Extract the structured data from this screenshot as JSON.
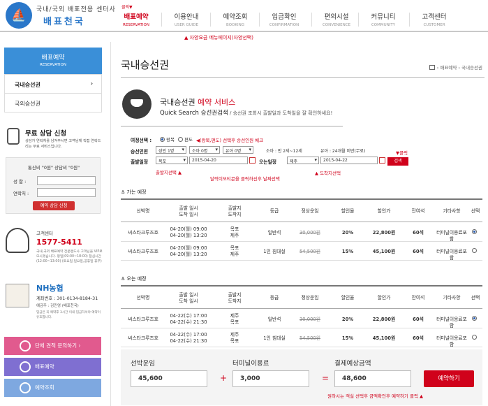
{
  "header": {
    "logo_text1": "국내/국외 배표전용 센터사",
    "logo_text2": "배표천국",
    "click_hint": "클릭▼",
    "nav": [
      {
        "k": "배표예약",
        "e": "RESERVATION",
        "active": true
      },
      {
        "k": "이용안내",
        "e": "USER GUIDE"
      },
      {
        "k": "예약조회",
        "e": "BOOKING"
      },
      {
        "k": "입금확인",
        "e": "CONFIRMATION"
      },
      {
        "k": "편의시설",
        "e": "CONVENIENCE"
      },
      {
        "k": "커뮤니티",
        "e": "COMMUNITY"
      },
      {
        "k": "고객센터",
        "e": "CUSTOMER"
      }
    ],
    "menu_tip": "▲ 자양요금 메뉴페이지(자양선택)"
  },
  "sidebar": {
    "top_k": "배표예약",
    "top_e": "RESERVATION",
    "items": [
      {
        "label": "국내승선권",
        "arrow": "›"
      },
      {
        "label": "국외승선권"
      }
    ],
    "consult_title": "무료 상담 신청",
    "consult_desc": "상담가 연락처를 남겨주시면 고객님께 직접 연락드리는 무료 서비스입니다.",
    "consult_head": "통신비 \"0원\" 상담비 \"0원\"",
    "name_label": "성 함 :",
    "phone_label": "연락처 :",
    "apply_label": "예약 상담 신청",
    "cs_label": "고객센터",
    "cs_phone": "1577-5411",
    "cs_desc": "국내,국외 배표예약 전문랜드사 고객님을 VIP로 모시겠습니다. 평일(09:00~18:00) 점심시간(12:00~13:00) (토요일,일요일,공휴일 휴무)",
    "nh_logo": "NH농협",
    "nh_acct": "계좌번호 : 301-0134-8184-31",
    "nh_name": "예금주 : 김민영 (배표천국)",
    "nh_note": "입금은 꼭 예약후 3시간 이내 입금하셔야 예약이 유효합니다.",
    "btn_group": "단체 견적 문의하기 ›",
    "btn_reserve": "배표예약",
    "btn_inquiry": "예약조회"
  },
  "main": {
    "title": "국내승선권",
    "breadcrumb": "› 배표예약 › 국내승선권",
    "svc_title_a": "국내승선권",
    "svc_title_b": "예약 서비스",
    "svc_sub_a": "Quick Search 승선권검색",
    "svc_sub_b": "/ 승선권 조회시 출발일과 도착일을 잘 확인하세요!"
  },
  "search": {
    "trip_label": "여정선택 :",
    "round": "왕복",
    "oneway": "편도",
    "trip_tip": "◀(왕복,편도) 선택후 승선인원 체크",
    "pax_label": "승선인원",
    "adult": "성인 1명",
    "child": "소아 0명",
    "infant": "유아 0명",
    "child_note": "소아 : 만 2세~12세",
    "infant_note": "유아 : 24개월 미만(무료)",
    "click_tip": "▼클릭",
    "dep_label": "출발일정",
    "dep_port": "목포",
    "dep_date": "2015-04-20",
    "ret_label": "오는일정",
    "ret_port": "제주",
    "ret_date": "2015-04-22",
    "search_btn": "검색",
    "tip_dep": "출발지선택 ▲",
    "tip_cal": "달력이모티콘을 클릭하신후 날짜선택",
    "tip_arr": "▲ 도착지선택"
  },
  "columns": [
    "선박명",
    "출발 일시|도착 일시",
    "출발지|도착지",
    "등급",
    "정상운임",
    "할인율",
    "할인가",
    "잔여석",
    "기타사항",
    "선택"
  ],
  "go": {
    "head": "⚓ 가는 예정",
    "rows": [
      {
        "ship": "씨스타크루즈호",
        "t1": "04-20(월) 09:00",
        "t2": "04-20(월) 13:20",
        "p1": "목포",
        "p2": "제주",
        "grade": "일반석",
        "reg": "30,000원",
        "rate": "20%",
        "price": "22,800원",
        "seats": "60석",
        "etc": "터미널이용료포함",
        "sel": true
      },
      {
        "ship": "씨스타크루즈호",
        "t1": "04-20(월) 09:00",
        "t2": "04-20(월) 13:20",
        "p1": "목포",
        "p2": "제주",
        "grade": "1인 침대실",
        "reg": "54,500원",
        "rate": "15%",
        "price": "45,100원",
        "seats": "60석",
        "etc": "터미널이용료포함",
        "sel": false
      }
    ]
  },
  "back": {
    "head": "⚓ 오는 예정",
    "rows": [
      {
        "ship": "씨스타크루즈호",
        "t1": "04-22(수) 17:00",
        "t2": "04-22(수) 21:30",
        "p1": "제주",
        "p2": "목포",
        "grade": "일반석",
        "reg": "30,000원",
        "rate": "20%",
        "price": "22,800원",
        "seats": "60석",
        "etc": "터미널이용료포함",
        "sel": true
      },
      {
        "ship": "씨스타크루즈호",
        "t1": "04-22(수) 17:00",
        "t2": "04-22(수) 21:30",
        "p1": "제주",
        "p2": "목포",
        "grade": "1인 침대실",
        "reg": "54,500원",
        "rate": "15%",
        "price": "45,100원",
        "seats": "60석",
        "etc": "터미널이용료포함",
        "sel": false
      }
    ]
  },
  "totals": {
    "fare_label": "선박운임",
    "fare": "45,600",
    "plus": "+",
    "terminal_label": "터미널이용료",
    "terminal": "3,000",
    "eq": "=",
    "total_label": "결제예상금액",
    "total": "48,600",
    "reserve_btn": "예약하기",
    "tip": "원하시는 객실 선택후 금액확인후 예약하기 클릭 ▲"
  }
}
